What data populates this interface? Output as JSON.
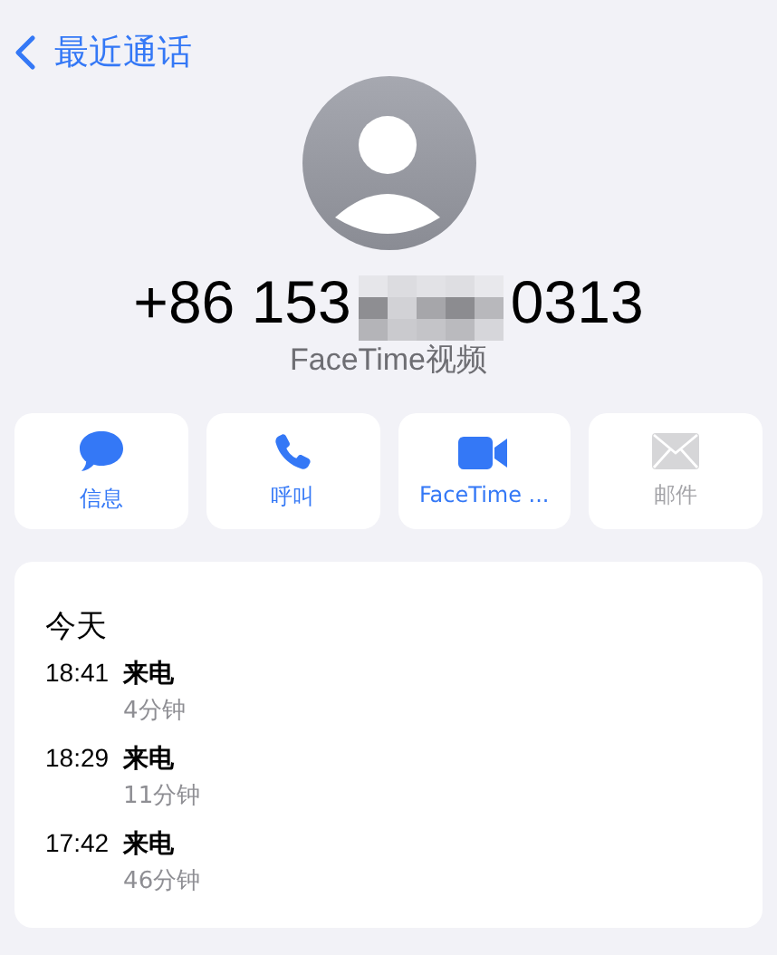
{
  "nav": {
    "back_label": "最近通话"
  },
  "contact": {
    "number_start": "+86 153",
    "number_end": "0313",
    "subtitle": "FaceTime视频"
  },
  "actions": [
    {
      "kind": "message",
      "label": "信息",
      "disabled": false
    },
    {
      "kind": "call",
      "label": "呼叫",
      "disabled": false
    },
    {
      "kind": "video",
      "label": "FaceTime ...",
      "disabled": false
    },
    {
      "kind": "mail",
      "label": "邮件",
      "disabled": true
    }
  ],
  "history": {
    "heading": "今天",
    "calls": [
      {
        "time": "18:41",
        "type": "来电",
        "duration": "4分钟"
      },
      {
        "time": "18:29",
        "type": "来电",
        "duration": "11分钟"
      },
      {
        "time": "17:42",
        "type": "来电",
        "duration": "46分钟"
      }
    ]
  }
}
